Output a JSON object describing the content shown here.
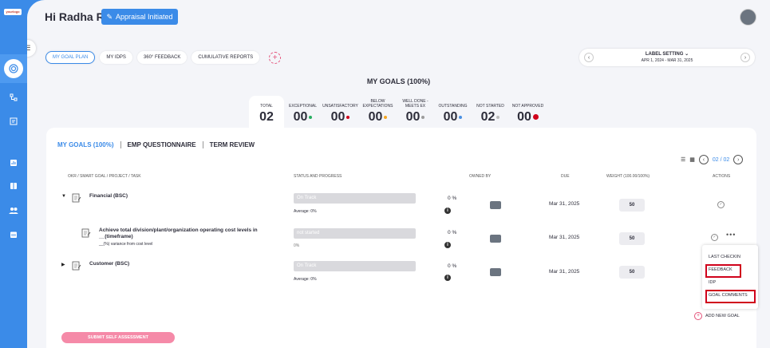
{
  "sidebar": {
    "logo_text": "yourlogo",
    "icons": [
      "menu-icon",
      "goal-target-icon",
      "hierarchy-icon",
      "document-icon",
      "report-icon",
      "book-icon",
      "team-icon",
      "calendar-icon"
    ]
  },
  "header": {
    "greeting": "Hi Radha R",
    "status_button": "Appraisal Initiated"
  },
  "tabs": [
    "MY GOAL PLAN",
    "MY IDPS",
    "360° FEEDBACK",
    "CUMULATIVE REPORTS"
  ],
  "label_setting": {
    "title": "LABEL SETTING",
    "date_range": "APR 1, 2024 - MAR 31, 2025"
  },
  "summary": {
    "title": "MY GOALS (100%)",
    "stats": [
      {
        "label": "TOTAL",
        "value": "02",
        "color": ""
      },
      {
        "label": "EXCEPTIONAL",
        "value": "00",
        "color": "#27ae60"
      },
      {
        "label": "UNSATISFACTORY",
        "value": "00",
        "color": "#d0021b"
      },
      {
        "label": "BELOW EXPECTATIONS",
        "value": "00",
        "color": "#f5a623"
      },
      {
        "label": "WELL DONE - MEETS EX",
        "value": "00",
        "color": "#9b9b9b"
      },
      {
        "label": "OUTSTANDING",
        "value": "00",
        "color": "#4a90e2"
      },
      {
        "label": "NOT STARTED",
        "value": "02",
        "color": "#bbbbbb"
      },
      {
        "label": "NOT APPROVED",
        "value": "00",
        "color": "#d0021b"
      }
    ]
  },
  "subtabs": [
    "MY GOALS (100%)",
    "EMP QUESTIONNAIRE",
    "TERM REVIEW"
  ],
  "pagination": "02 / 02",
  "columns": {
    "okr": "OKR / SMART GOAL / PROJECT / TASK",
    "status": "STATUS AND PROGRESS",
    "owned_by": "OWNED BY",
    "due": "DUE",
    "weight": "WEIGHT (100.00/100%)",
    "actions": "ACTIONS"
  },
  "rows": [
    {
      "name": "Financial (BSC)",
      "status": "On Track",
      "avg": "Average: 0%",
      "pct": "0",
      "due": "Mar 31, 2025",
      "weight": "50"
    },
    {
      "name": "Achieve total division/plant/organization operating cost levels in __(timeframe)",
      "sub": "__(%) variance from cost level",
      "status": "not started",
      "avg": "0%",
      "pct": "0",
      "due": "Mar 31, 2025",
      "weight": "50"
    },
    {
      "name": "Customer (BSC)",
      "status": "On Track",
      "avg": "Average: 0%",
      "pct": "0",
      "due": "Mar 31, 2025",
      "weight": "50"
    }
  ],
  "pct_sign": "%",
  "action_menu": [
    "LAST CHECKIN",
    "FEEDBACK",
    "IDP",
    "GOAL COMMENTS"
  ],
  "add_goal": "ADD NEW GOAL",
  "submit": "SUBMIT SELF ASSESSMENT"
}
